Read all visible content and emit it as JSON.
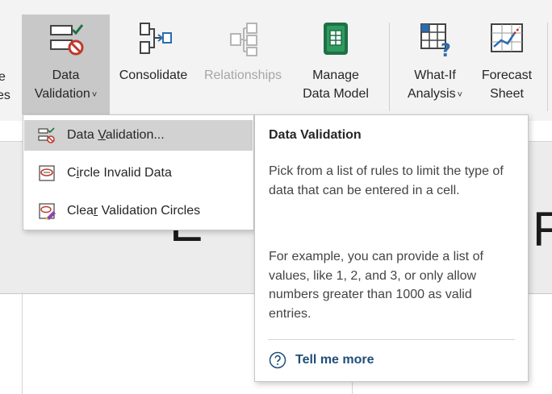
{
  "ribbon": {
    "partial_left_line1": "e",
    "partial_left_line2": "es",
    "buttons": [
      {
        "label1": "Data",
        "label2": "Validation",
        "caret": "˅",
        "icon": "data-validation-icon"
      },
      {
        "label1": "Consolidate",
        "icon": "consolidate-icon"
      },
      {
        "label1": "Relationships",
        "icon": "relationships-icon",
        "disabled": true
      },
      {
        "label1": "Manage",
        "label2": "Data Model",
        "icon": "manage-data-model-icon"
      },
      {
        "label1": "What-If",
        "label2": "Analysis",
        "caret": "˅",
        "icon": "what-if-analysis-icon"
      },
      {
        "label1": "Forecast",
        "label2": "Sheet",
        "icon": "forecast-sheet-icon"
      }
    ]
  },
  "menu": {
    "items": [
      {
        "pre": "Data ",
        "accel": "V",
        "post": "alidation...",
        "icon": "data-validation-icon"
      },
      {
        "pre": "C",
        "accel": "i",
        "post": "rcle Invalid Data",
        "icon": "circle-invalid-icon"
      },
      {
        "pre": "Clea",
        "accel": "r",
        "post": " Validation Circles",
        "icon": "clear-circles-icon"
      }
    ]
  },
  "tooltip": {
    "title": "Data Validation",
    "para1": "Pick from a list of rules to limit the type of data that can be entered in a cell.",
    "para2": "For example, you can provide a list of values, like 1, 2, and 3, or only allow numbers greater than 1000 as valid entries.",
    "link": "Tell me more",
    "link_icon": "help-circle-icon"
  },
  "sheet": {
    "col_e": "E",
    "col_f": "F"
  },
  "colors": {
    "ribbon_bg": "#f3f3f3",
    "active_button": "#c8c8c8",
    "menu_hover": "#d2d2d2",
    "link": "#1f4e79",
    "excel_green": "#1e7145",
    "validation_red": "#c0392b"
  }
}
